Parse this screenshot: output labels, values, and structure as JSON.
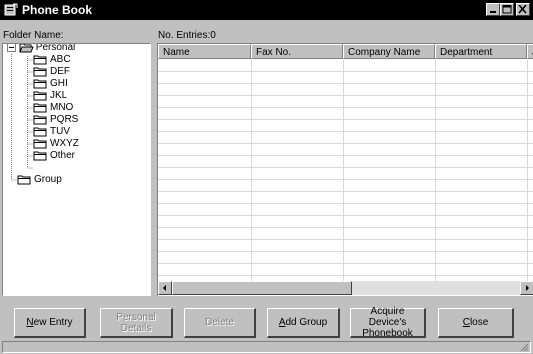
{
  "window": {
    "title": "Phone Book"
  },
  "folder_pane": {
    "label": "Folder Name:"
  },
  "list_pane": {
    "label": "No. Entries:0"
  },
  "tree": {
    "root": "Personal",
    "children": [
      "ABC",
      "DEF",
      "GHI",
      "JKL",
      "MNO",
      "PQRS",
      "TUV",
      "WXYZ",
      "Other"
    ],
    "group": "Group"
  },
  "columns": [
    "Name",
    "Fax No.",
    "Company Name",
    "Department",
    "J"
  ],
  "buttons": {
    "new_entry": {
      "underline": "N",
      "rest": "ew Entry"
    },
    "personal_details": {
      "label_a": "Personal Det",
      "label_b": "ails"
    },
    "delete": "Delete",
    "add_group": {
      "underline": "A",
      "rest": "dd Group"
    },
    "acquire_line1": "Acquire Device's",
    "acquire_line2": "Phonebook",
    "close": {
      "underline": "C",
      "rest": "lose"
    }
  }
}
